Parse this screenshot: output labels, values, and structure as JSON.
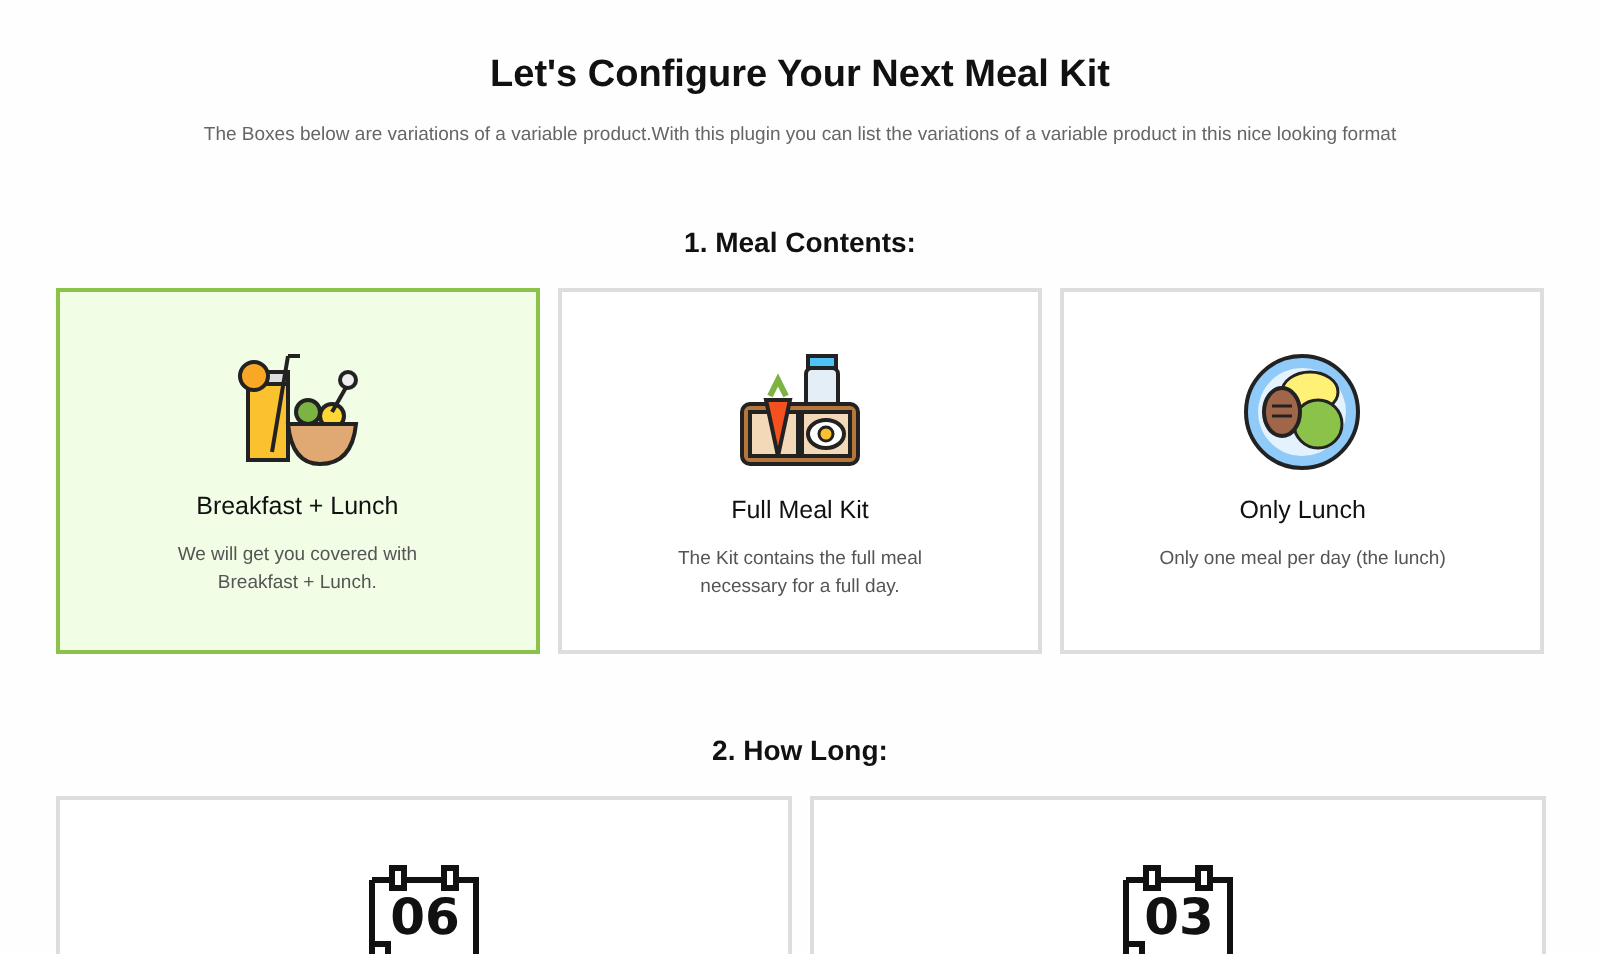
{
  "title": "Let's Configure Your Next Meal Kit",
  "subtitle": "The Boxes below are variations of a variable product.With this plugin you can list the variations of a variable product in this nice looking format",
  "sections": [
    {
      "heading": "1. Meal Contents:",
      "options": [
        {
          "kind": "drink-bowl",
          "title": "Breakfast + Lunch",
          "description": "We will get you covered with Breakfast + Lunch.",
          "selected": true
        },
        {
          "kind": "lunchbox",
          "title": "Full Meal Kit",
          "description": "The Kit contains the full meal necessary for a full day.",
          "selected": false
        },
        {
          "kind": "plate",
          "title": "Only Lunch",
          "description": "Only one meal per day (the lunch)",
          "selected": false
        }
      ]
    },
    {
      "heading": "2. How Long:",
      "options": [
        {
          "kind": "calendar",
          "number": "06",
          "selected": false
        },
        {
          "kind": "calendar",
          "number": "03",
          "selected": false
        }
      ]
    }
  ]
}
